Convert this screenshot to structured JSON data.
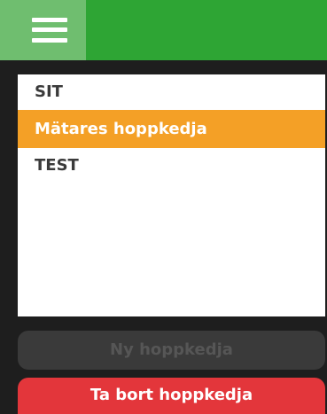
{
  "header": {
    "menu_icon": "hamburger-menu-icon",
    "colors": {
      "bar": "#2ea534",
      "menu_button": "#6fbe6f"
    }
  },
  "chains": {
    "items": [
      {
        "label": "SIT",
        "selected": false
      },
      {
        "label": "Mätares hoppkedja",
        "selected": true
      },
      {
        "label": "TEST",
        "selected": false
      }
    ],
    "selected_color": "#f4a026"
  },
  "actions": {
    "new_label": "Ny hoppkedja",
    "new_enabled": false,
    "delete_label": "Ta bort hoppkedja",
    "delete_color": "#e3363b"
  }
}
